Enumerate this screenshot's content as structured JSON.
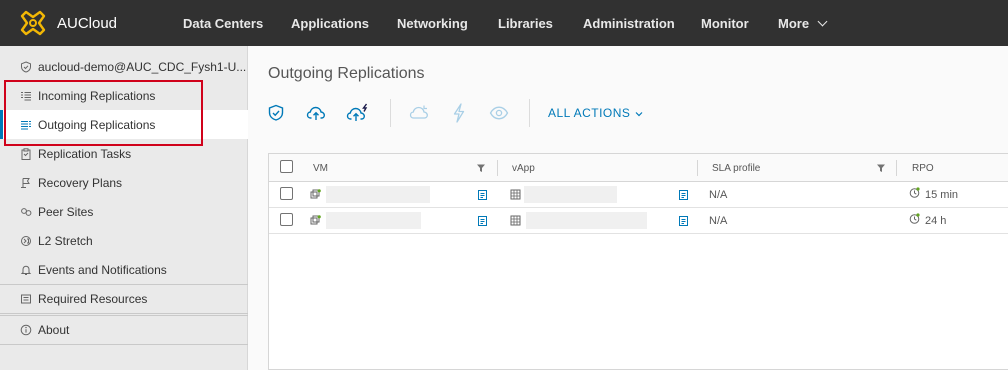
{
  "app": {
    "name": "AUCloud",
    "brand_color": "#f2b705"
  },
  "nav": {
    "items": [
      {
        "label": "Data Centers"
      },
      {
        "label": "Applications"
      },
      {
        "label": "Networking"
      },
      {
        "label": "Libraries"
      },
      {
        "label": "Administration"
      },
      {
        "label": "Monitor"
      }
    ],
    "more_label": "More"
  },
  "sidebar": {
    "items": [
      {
        "label": "aucloud-demo@AUC_CDC_Fysh1-U...",
        "icon": "shield-icon"
      },
      {
        "label": "Incoming Replications",
        "icon": "incoming-list-icon"
      },
      {
        "label": "Outgoing Replications",
        "icon": "outgoing-list-icon",
        "active": true
      },
      {
        "label": "Replication Tasks",
        "icon": "clipboard-icon"
      },
      {
        "label": "Recovery Plans",
        "icon": "recovery-plan-icon"
      },
      {
        "label": "Peer Sites",
        "icon": "peer-sites-icon"
      },
      {
        "label": "L2 Stretch",
        "icon": "l2-stretch-icon"
      },
      {
        "label": "Events and Notifications",
        "icon": "bell-icon"
      },
      {
        "label": "Required Resources",
        "icon": "resources-icon"
      },
      {
        "label": "About",
        "icon": "info-icon"
      }
    ]
  },
  "main": {
    "title": "Outgoing Replications",
    "toolbar": {
      "icons": [
        "shield-check-icon",
        "cloud-upload-icon",
        "cloud-lightning-icon",
        "cloud-sync-icon",
        "lightning-icon",
        "eye-icon"
      ],
      "all_actions_label": "ALL ACTIONS"
    },
    "grid": {
      "columns": [
        "VM",
        "vApp",
        "SLA profile",
        "RPO"
      ],
      "rows": [
        {
          "sla": "N/A",
          "rpo": "15 min"
        },
        {
          "sla": "N/A",
          "rpo": "24 h"
        }
      ]
    }
  },
  "colors": {
    "accent": "#0079b8",
    "highlight": "#d0021b",
    "topbar": "#313131"
  }
}
